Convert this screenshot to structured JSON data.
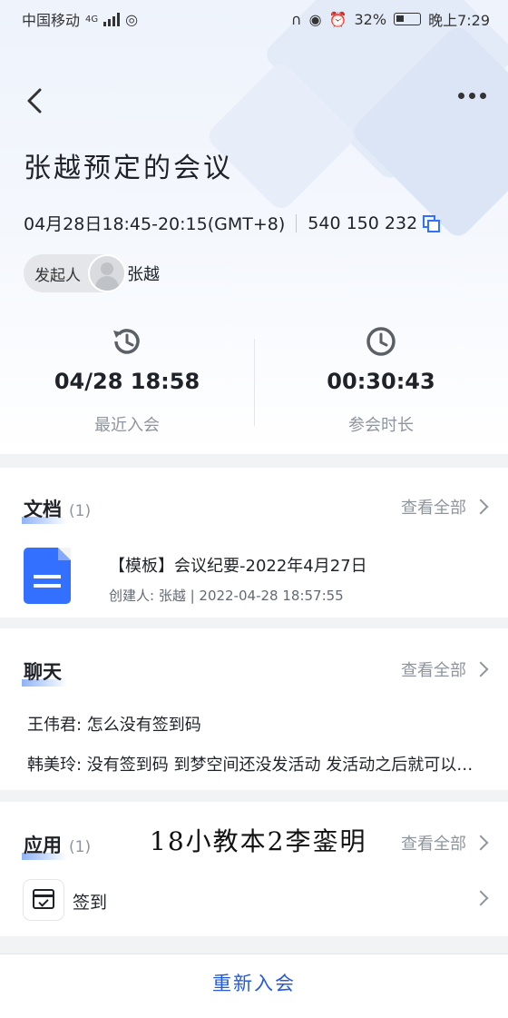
{
  "status_bar": {
    "carrier": "中国移动",
    "network": "4G",
    "battery": "32%",
    "time": "晚上7:29"
  },
  "meeting": {
    "title": "张越预定的会议",
    "time": "04月28日18:45-20:15(GMT+8)",
    "meeting_id": "540 150 232",
    "host_label": "发起人",
    "host_name": "张越"
  },
  "stats": [
    {
      "value": "04/28 18:58",
      "label": "最近入会",
      "icon": "history-clock-icon"
    },
    {
      "value": "00:30:43",
      "label": "参会时长",
      "icon": "clock-icon"
    }
  ],
  "documents": {
    "title": "文档",
    "count": "(1)",
    "view_all": "查看全部",
    "items": [
      {
        "name": "【模板】会议纪要-2022年4月27日",
        "meta": "创建人:  张越 | 2022-04-28 18:57:55",
        "icon": "doc-icon"
      }
    ]
  },
  "chat": {
    "title": "聊天",
    "view_all": "查看全部",
    "messages": [
      "王伟君: 怎么没有签到码",
      "韩美玲: 没有签到码 到梦空间还没发活动 发活动之后就可以签到了"
    ]
  },
  "apps": {
    "title": "应用",
    "count": "(1)",
    "view_all": "查看全部",
    "handwritten_note": "18小教本2李銮明",
    "items": [
      {
        "name": "签到",
        "icon": "calendar-check-icon"
      }
    ]
  },
  "bottom": {
    "rejoin_label": "重新入会"
  },
  "colors": {
    "accent": "#3370ff",
    "link": "#245bdb",
    "muted": "#8f959e"
  }
}
